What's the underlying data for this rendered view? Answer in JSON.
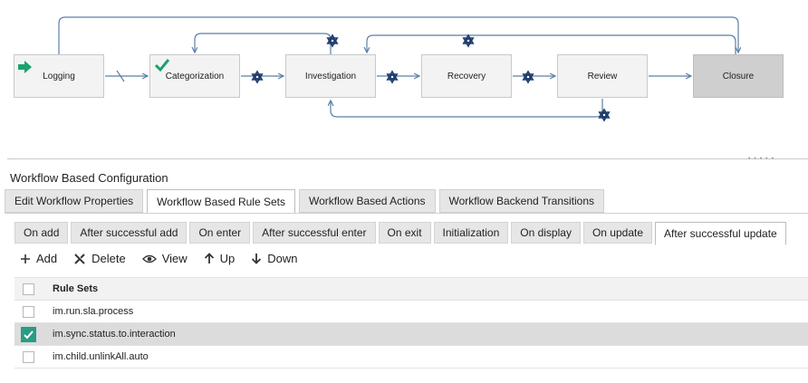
{
  "workflow": {
    "nodes": [
      {
        "id": "logging",
        "label": "Logging"
      },
      {
        "id": "categorization",
        "label": "Categorization"
      },
      {
        "id": "investigation",
        "label": "Investigation"
      },
      {
        "id": "recovery",
        "label": "Recovery"
      },
      {
        "id": "review",
        "label": "Review"
      },
      {
        "id": "closure",
        "label": "Closure"
      }
    ],
    "colors": {
      "line": "#5b7fa8",
      "gear": "#1d3a6b",
      "start": "#1aa36b",
      "check": "#1aa36b"
    }
  },
  "config": {
    "title": "Workflow Based Configuration",
    "tabs": [
      {
        "label": "Edit Workflow Properties",
        "active": false
      },
      {
        "label": "Workflow Based Rule Sets",
        "active": true
      },
      {
        "label": "Workflow Based Actions",
        "active": false
      },
      {
        "label": "Workflow Backend Transitions",
        "active": false
      }
    ],
    "subtabs": [
      {
        "label": "On add",
        "active": false
      },
      {
        "label": "After successful add",
        "active": false
      },
      {
        "label": "On enter",
        "active": false
      },
      {
        "label": "After successful enter",
        "active": false
      },
      {
        "label": "On exit",
        "active": false
      },
      {
        "label": "Initialization",
        "active": false
      },
      {
        "label": "On display",
        "active": false
      },
      {
        "label": "On update",
        "active": false
      },
      {
        "label": "After successful update",
        "active": true
      }
    ],
    "toolbar": {
      "add": "Add",
      "delete": "Delete",
      "view": "View",
      "up": "Up",
      "down": "Down"
    },
    "table": {
      "header": "Rule Sets",
      "rows": [
        {
          "name": "im.run.sla.process",
          "checked": false
        },
        {
          "name": "im.sync.status.to.interaction",
          "checked": true
        },
        {
          "name": "im.child.unlinkAll.auto",
          "checked": false
        }
      ]
    }
  }
}
